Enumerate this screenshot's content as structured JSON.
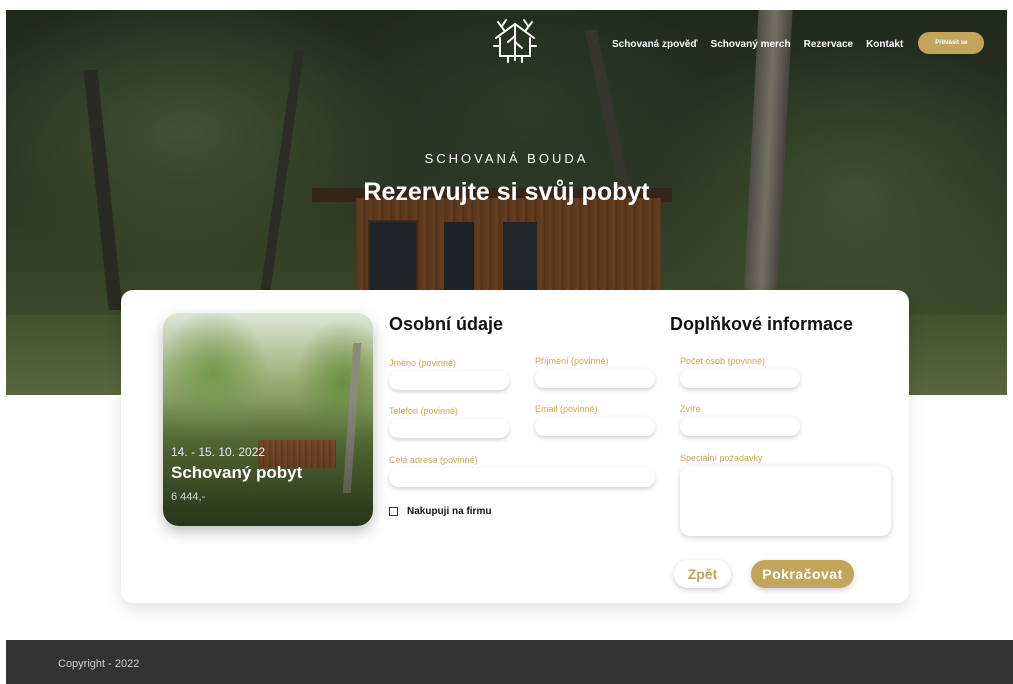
{
  "brand": {
    "logo_icon": "cabin-trees-logo-icon"
  },
  "nav": {
    "items": [
      "Schovaná zpověď",
      "Schovaný merch",
      "Rezervace",
      "Kontakt"
    ],
    "login_label": "Přihlásit se"
  },
  "hero": {
    "eyebrow": "SCHOVANÁ BOUDA",
    "headline": "Rezervujte si svůj pobyt"
  },
  "booking": {
    "date": "14. - 15. 10. 2022",
    "title": "Schovaný pobyt",
    "price": "6 444,-"
  },
  "personal": {
    "title": "Osobní údaje",
    "fields": {
      "first_name": "Jméno (povinné)",
      "last_name": "Příjmení (povinné)",
      "phone": "Telefon (povinné)",
      "email": "Email (povinné)",
      "address": "Celá adresa (povinné)"
    },
    "company_checkbox": "Nakupuji na firmu"
  },
  "extra": {
    "title": "Doplňkové informace",
    "fields": {
      "persons": "Počet osob (povinné)",
      "animals": "Zvíře",
      "special": "Speciální požadavky"
    }
  },
  "actions": {
    "back": "Zpět",
    "next": "Pokračovat"
  },
  "footer": {
    "copyright": "Copyright - 2022"
  },
  "colors": {
    "accent": "#c2a55b",
    "footer_bg": "#333333"
  }
}
